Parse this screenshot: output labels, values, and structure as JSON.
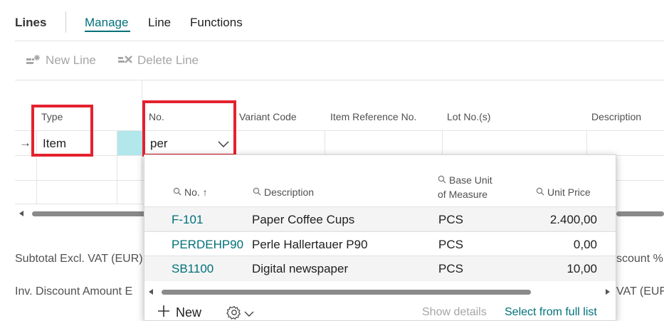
{
  "tabs": {
    "title": "Lines",
    "items": [
      "Manage",
      "Line",
      "Functions"
    ],
    "active": "Manage"
  },
  "actions": {
    "new_line": "New Line",
    "delete_line": "Delete Line"
  },
  "columns": {
    "type": "Type",
    "no": "No.",
    "variant_code": "Variant Code",
    "item_reference_no": "Item Reference No.",
    "lot_no": "Lot No.(s)",
    "description": "Description"
  },
  "current_row": {
    "type": "Item",
    "no_input_value": "per"
  },
  "totals": {
    "subtotal_label": "Subtotal Excl. VAT (EUR)",
    "inv_discount_label": "Inv. Discount Amount E",
    "right_label_1": "scount %",
    "right_label_2": "VAT (EUF"
  },
  "dropdown": {
    "headers": {
      "no": "No. ↑",
      "description": "Description",
      "uom_line1": "Base Unit",
      "uom_line2": "of Measure",
      "unit_price": "Unit Price"
    },
    "rows": [
      {
        "no": "F-101",
        "description": "Paper Coffee Cups",
        "uom": "PCS",
        "unit_price": "2.400,00"
      },
      {
        "no": "PERDEHP90",
        "description": "Perle Hallertauer P90",
        "uom": "PCS",
        "unit_price": "0,00"
      },
      {
        "no": "SB1100",
        "description": "Digital newspaper",
        "uom": "PCS",
        "unit_price": "10,00"
      }
    ],
    "footer": {
      "new_label": "New",
      "show_details": "Show details",
      "select_full_list": "Select from full list"
    }
  },
  "colors": {
    "accent": "#00707a",
    "highlight_cell": "#b2e7ec",
    "annotation_red": "#e4212f"
  }
}
